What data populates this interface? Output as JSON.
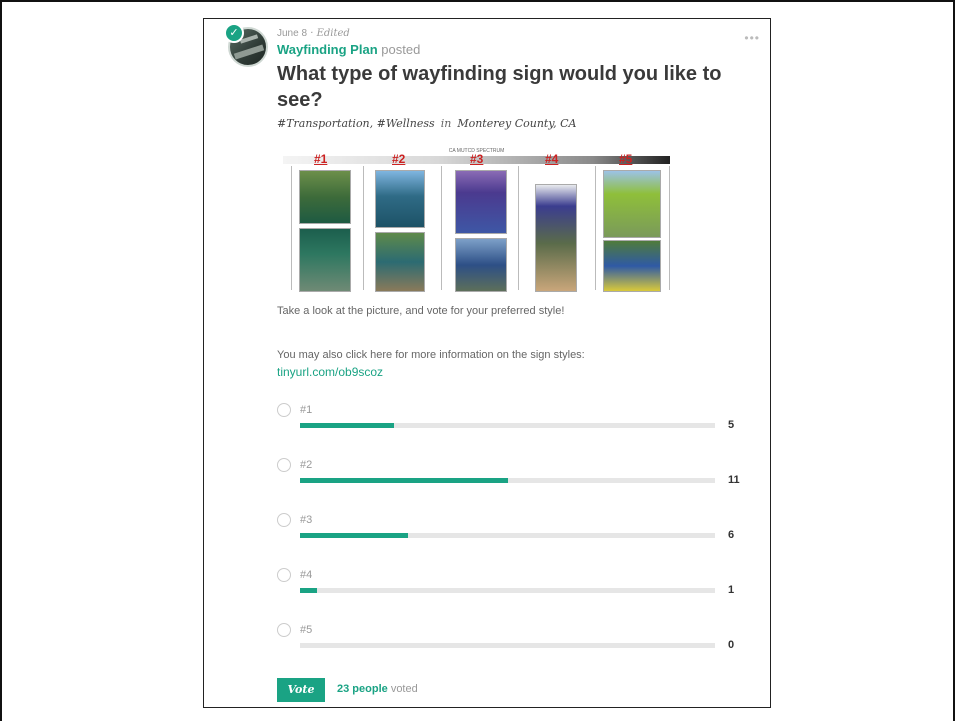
{
  "post": {
    "date": "June 8",
    "edited": "Edited",
    "organization": "Wayfinding Plan",
    "posted_label": "posted",
    "more_icon": "ellipsis-icon",
    "title": "What type of wayfinding sign would you like to see?",
    "tags": "#Transportation, #Wellness",
    "in_label": "in",
    "location": "Monterey County, CA",
    "image": {
      "spectrum_label": "CA MUTCD SPECTRUM",
      "numbers": [
        "#1",
        "#2",
        "#3",
        "#4",
        "#5"
      ]
    },
    "description": "Take a look at the picture, and vote for your preferred style!",
    "more_info": "You may also click here for more information on the sign styles:",
    "link": "tinyurl.com/ob9scoz"
  },
  "poll": {
    "options": [
      {
        "label": "#1",
        "count": "5",
        "fraction": 0.227
      },
      {
        "label": "#2",
        "count": "11",
        "fraction": 0.5
      },
      {
        "label": "#3",
        "count": "6",
        "fraction": 0.26
      },
      {
        "label": "#4",
        "count": "1",
        "fraction": 0.04
      },
      {
        "label": "#5",
        "count": "0",
        "fraction": 0
      }
    ],
    "vote_button": "Vote",
    "people": "23 people",
    "voted_label": "voted"
  },
  "colors": {
    "accent": "#1aa384",
    "sign_number": "#cc2222"
  }
}
